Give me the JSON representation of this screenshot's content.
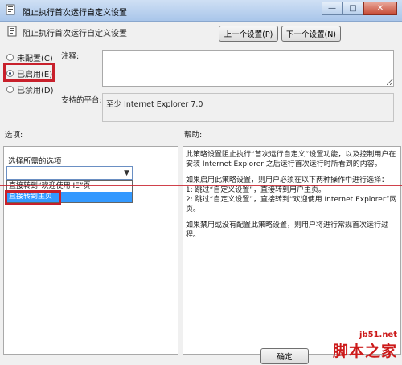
{
  "window": {
    "title": "阻止执行首次运行自定义设置"
  },
  "header": {
    "title": "阻止执行首次运行自定义设置",
    "prev_label": "上一个设置(P)",
    "next_label": "下一个设置(N)"
  },
  "state": {
    "options": [
      {
        "label": "未配置(C)",
        "checked": false
      },
      {
        "label": "已启用(E)",
        "checked": true
      },
      {
        "label": "已禁用(D)",
        "checked": false
      }
    ]
  },
  "fields": {
    "comment_label": "注释:",
    "comment_value": "",
    "platform_label": "支持的平台:",
    "platform_value": "至少 Internet Explorer 7.0"
  },
  "options_section": {
    "label": "选项:",
    "select_prompt": "选择所需的选项",
    "select_value": "",
    "dropdown": [
      "直接转到“欢迎使用 IE”页",
      "直接转到主页"
    ],
    "selected_index": 1
  },
  "help_section": {
    "label": "帮助:",
    "paragraphs": [
      "此策略设置阻止执行“首次运行自定义”设置功能，以及控制用户在安装 Internet Explorer 之后运行首次运行时所看到的内容。",
      "如果启用此策略设置，则用户必须在以下两种操作中进行选择：\n1: 跳过“自定义设置”，直接转到用户主页。\n2: 跳过“自定义设置”，直接转到“欢迎使用 Internet Explorer”网页。",
      "如果禁用或没有配置此策略设置，则用户将进行常规首次运行过程。"
    ]
  },
  "footer": {
    "ok_label": "确定"
  },
  "watermark": {
    "url": "jb51.net",
    "text": "脚本之家"
  },
  "colors": {
    "annotation_red": "#c8202b",
    "selection_blue": "#3399ff"
  }
}
